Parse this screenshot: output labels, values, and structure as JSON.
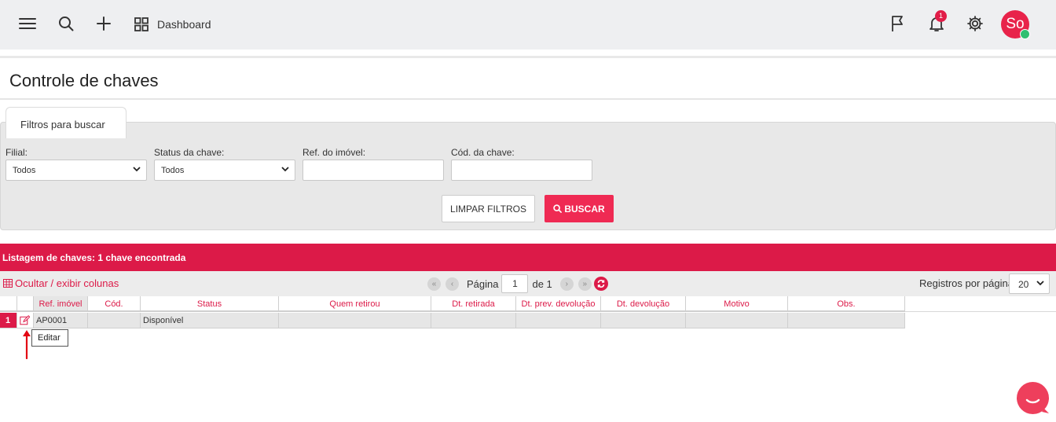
{
  "topbar": {
    "dashboard_label": "Dashboard",
    "notification_count": "1",
    "avatar_initials": "So"
  },
  "page": {
    "title": "Controle de chaves"
  },
  "filters": {
    "tab_label": "Filtros para buscar",
    "filial": {
      "label": "Filial:",
      "value": "Todos"
    },
    "status": {
      "label": "Status da chave:",
      "value": "Todos"
    },
    "ref_imovel": {
      "label": "Ref. do imóvel:",
      "value": ""
    },
    "cod_chave": {
      "label": "Cód. da chave:",
      "value": ""
    },
    "clear_label": "LIMPAR FILTROS",
    "search_label": "BUSCAR"
  },
  "listing": {
    "header": "Listagem de chaves: 1 chave encontrada",
    "toggle_columns": "Ocultar / exibir colunas",
    "pager": {
      "page_label": "Página",
      "page_value": "1",
      "of_label": "de 1"
    },
    "rows_per_page_label": "Registros por página",
    "rows_per_page_value": "20",
    "columns": [
      "Ref. imóvel",
      "Cód.",
      "Status",
      "Quem retirou",
      "Dt. retirada",
      "Dt. prev. devolução",
      "Dt. devolução",
      "Motivo",
      "Obs."
    ],
    "rows": [
      {
        "num": "1",
        "cells": [
          "AP0001",
          "",
          "Disponível",
          "",
          "",
          "",
          "",
          "",
          ""
        ]
      }
    ],
    "edit_tooltip": "Editar"
  },
  "colors": {
    "accent": "#dc1a48",
    "button": "#ef2a53",
    "topbar": "#eeeff1"
  }
}
